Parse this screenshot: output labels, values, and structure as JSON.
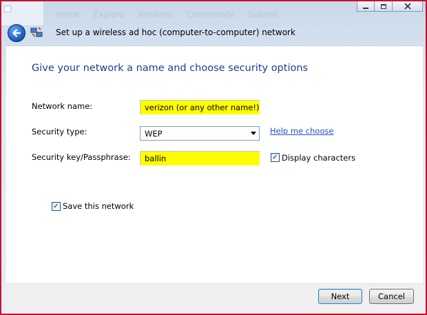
{
  "background_nav": [
    "Home",
    "Explore",
    "Answers",
    "Community",
    "Submit"
  ],
  "window_title": "Set up a wireless ad hoc (computer-to-computer) network",
  "heading": "Give your network a name and choose security options",
  "form": {
    "network_name_label": "Network name:",
    "network_name_value": "verizon (or any other name!)",
    "security_type_label": "Security type:",
    "security_type_value": "WEP",
    "help_link": "Help me choose",
    "security_key_label": "Security key/Passphrase:",
    "security_key_value": "ballin",
    "display_characters_label": "Display characters",
    "display_characters_checked": true,
    "save_network_label": "Save this network",
    "save_network_checked": true
  },
  "buttons": {
    "next": "Next",
    "cancel": "Cancel"
  },
  "colors": {
    "highlight": "#fffb00",
    "heading": "#1d3f8c",
    "link": "#1f4fc8",
    "outer_border": "#c8102e"
  }
}
